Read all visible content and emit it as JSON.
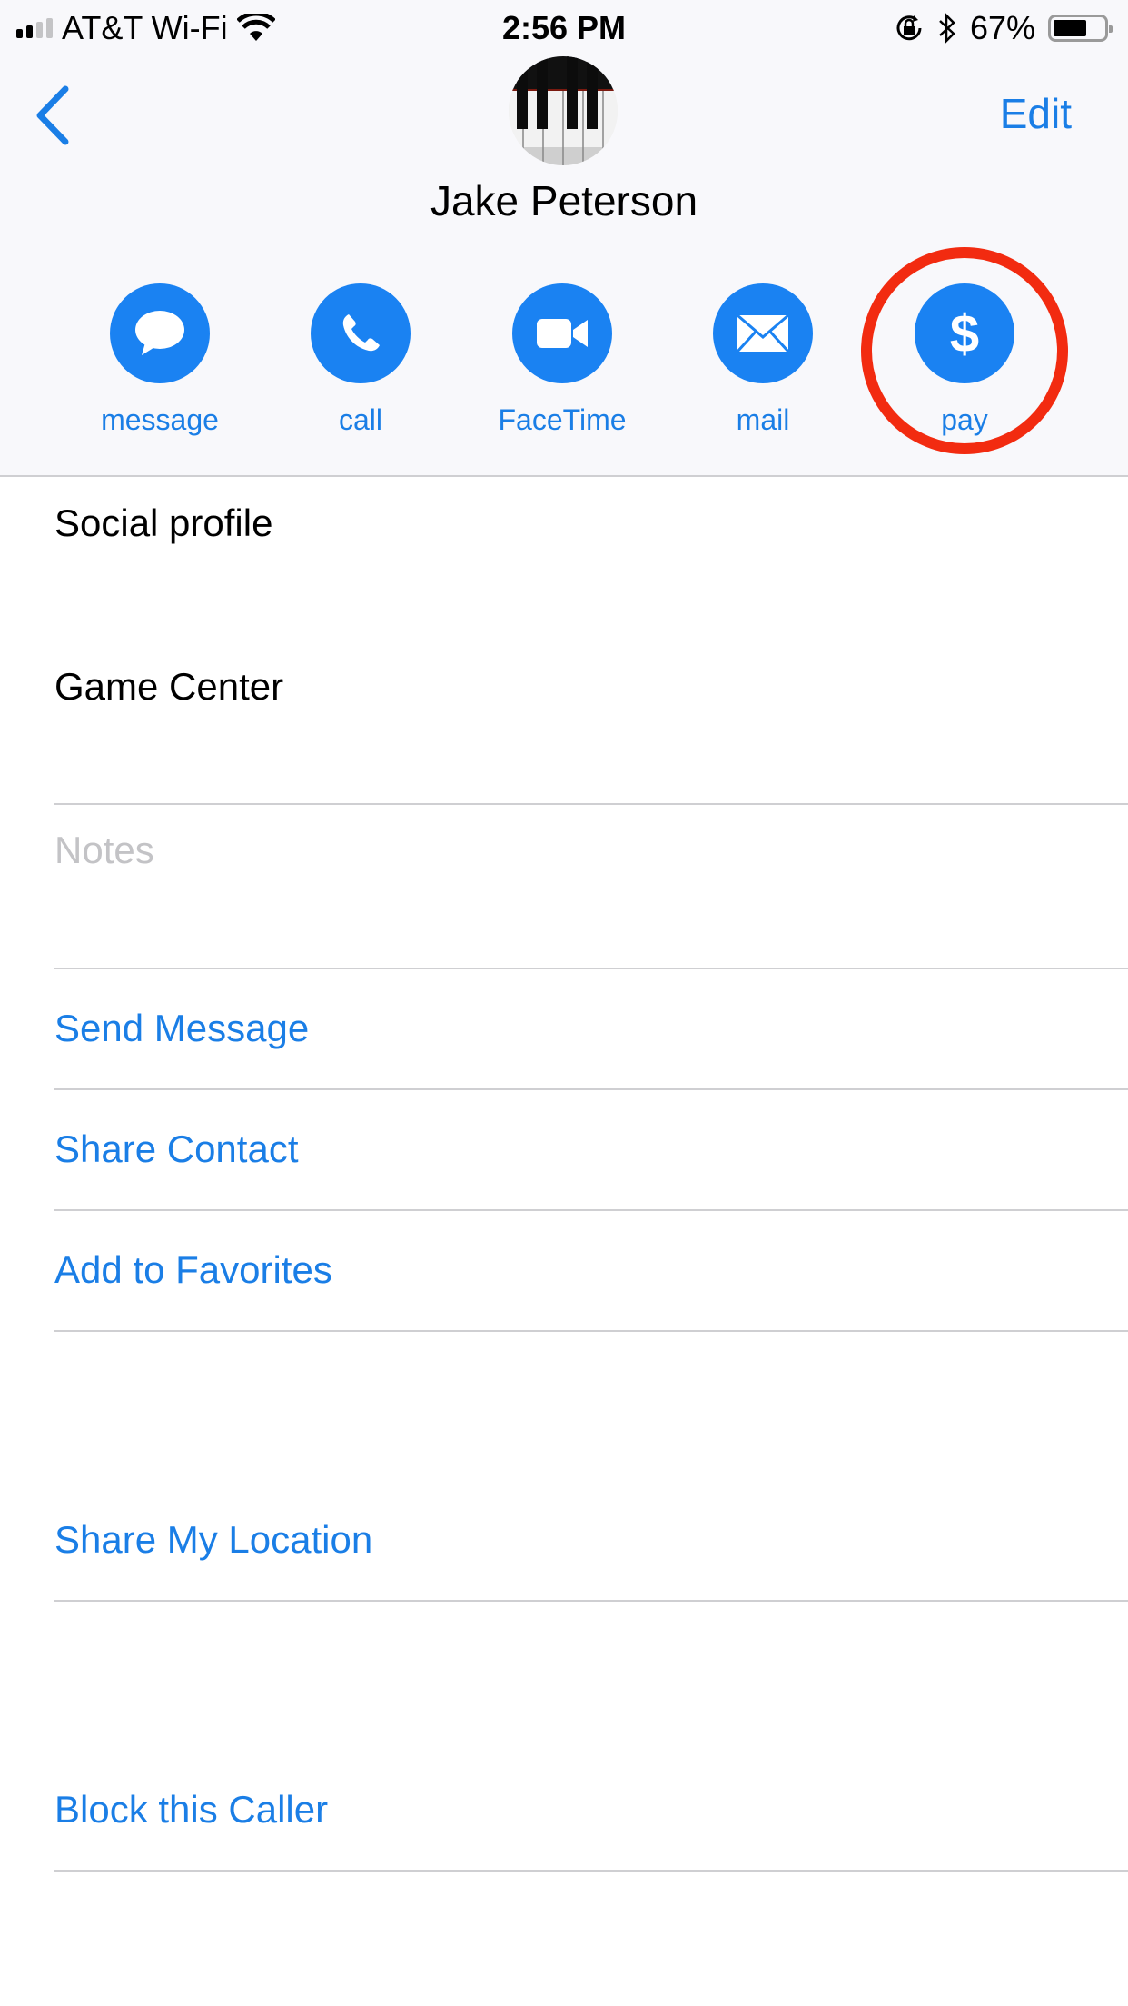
{
  "status_bar": {
    "carrier": "AT&T Wi-Fi",
    "time": "2:56 PM",
    "battery_percent": "67%",
    "battery_level": 0.67,
    "signal_bars_filled": 2,
    "signal_bars_total": 4,
    "icons": [
      "signal-icon",
      "wifi-icon",
      "rotation-lock-icon",
      "bluetooth-icon",
      "battery-icon"
    ]
  },
  "nav": {
    "back_icon": "chevron-left-icon",
    "edit_label": "Edit"
  },
  "contact": {
    "name": "Jake Peterson",
    "avatar": "piano-keys-photo"
  },
  "actions": [
    {
      "label": "message",
      "icon": "message-bubble-icon"
    },
    {
      "label": "call",
      "icon": "phone-icon"
    },
    {
      "label": "FaceTime",
      "icon": "video-camera-icon"
    },
    {
      "label": "mail",
      "icon": "envelope-icon"
    },
    {
      "label": "pay",
      "icon": "dollar-icon",
      "highlighted": true
    }
  ],
  "fields": {
    "social_profile": "Social profile",
    "game_center": "Game Center",
    "notes_placeholder": "Notes"
  },
  "links": {
    "send_message": "Send Message",
    "share_contact": "Share Contact",
    "add_to_favorites": "Add to Favorites",
    "share_location": "Share My Location",
    "block_caller": "Block this Caller"
  },
  "colors": {
    "accent": "#1a7ee6",
    "action_circle": "#1a82f2",
    "highlight_ring": "#f22b10",
    "header_bg": "#f8f8fb"
  }
}
